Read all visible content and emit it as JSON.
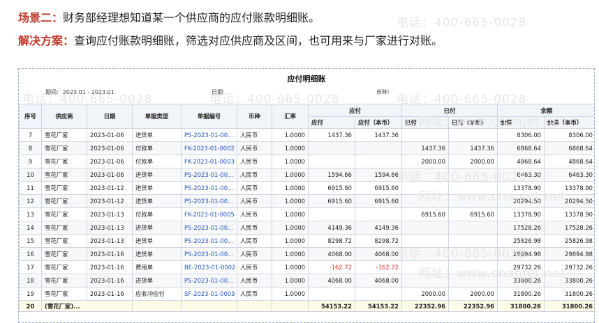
{
  "scenario": {
    "label": "场景二：",
    "text": "财务部经理想知道某一个供应商的应付账款明细账。"
  },
  "solution": {
    "label": "解决方案：",
    "text": "查询应付账款明细账，筛选对应供应商及区间，也可用来与厂家进行对账。"
  },
  "watermarks": {
    "phone": "电话：400-665-0028",
    "site": "网址：www.chanjet.net"
  },
  "report": {
    "title": "应付明细账",
    "period_label": "期间:",
    "period_value": "2023.01 - 2023.01",
    "date_label": "日期:",
    "currency_label": "币种:"
  },
  "columns": {
    "seq": "序号",
    "supplier": "供应商",
    "date": "日期",
    "doc_type": "单据类型",
    "doc_no": "单据编号",
    "currency": "币种",
    "rate": "汇率",
    "payable": "应付",
    "paid": "已付",
    "balance": "余额",
    "payable_amt": "应付",
    "payable_local": "应付（本币）",
    "paid_amt": "已付",
    "paid_local": "已付（本币）",
    "balance_amt": "余额",
    "balance_local": "余额（本币）"
  },
  "rows": [
    {
      "seq": "7",
      "supplier": "雪花厂家",
      "date": "2023-01-06",
      "type": "进货单",
      "no": "PS-2023-01-00...",
      "cur": "人民币",
      "rate": "1.0000",
      "pay": "1437.36",
      "payl": "1437.36",
      "paid": "",
      "paidl": "",
      "bal": "8306.00",
      "ball": "8306.00"
    },
    {
      "seq": "8",
      "supplier": "雪花厂家",
      "date": "2023-01-06",
      "type": "付款单",
      "no": "FK-2023-01-0002",
      "cur": "人民币",
      "rate": "1.0000",
      "pay": "",
      "payl": "",
      "paid": "1437.36",
      "paidl": "1437.36",
      "bal": "6868.64",
      "ball": "6868.64"
    },
    {
      "seq": "9",
      "supplier": "雪花厂家",
      "date": "2023-01-06",
      "type": "付款单",
      "no": "FK-2023-01-0003",
      "cur": "人民币",
      "rate": "1.0000",
      "pay": "",
      "payl": "",
      "paid": "2000.00",
      "paidl": "2000.00",
      "bal": "4868.64",
      "ball": "4868.64"
    },
    {
      "seq": "10",
      "supplier": "雪花厂家",
      "date": "2023-01-06",
      "type": "进货单",
      "no": "PS-2023-01-00...",
      "cur": "人民币",
      "rate": "1.0000",
      "pay": "1594.66",
      "payl": "1594.66",
      "paid": "",
      "paidl": "",
      "bal": "6463.30",
      "ball": "6463.30"
    },
    {
      "seq": "11",
      "supplier": "雪花厂家",
      "date": "2023-01-12",
      "type": "进货单",
      "no": "PS-2023-01-00...",
      "cur": "人民币",
      "rate": "1.0000",
      "pay": "6915.60",
      "payl": "6915.60",
      "paid": "",
      "paidl": "",
      "bal": "13378.90",
      "ball": "13378.90"
    },
    {
      "seq": "12",
      "supplier": "雪花厂家",
      "date": "2023-01-12",
      "type": "进货单",
      "no": "PS-2023-01-00...",
      "cur": "人民币",
      "rate": "1.0000",
      "pay": "6915.60",
      "payl": "6915.60",
      "paid": "",
      "paidl": "",
      "bal": "20294.50",
      "ball": "20294.50"
    },
    {
      "seq": "13",
      "supplier": "雪花厂家",
      "date": "2023-01-13",
      "type": "付款单",
      "no": "FK-2023-01-0005",
      "cur": "人民币",
      "rate": "1.0000",
      "pay": "",
      "payl": "",
      "paid": "6915.60",
      "paidl": "6915.60",
      "bal": "13378.90",
      "ball": "13378.90"
    },
    {
      "seq": "14",
      "supplier": "雪花厂家",
      "date": "2023-01-13",
      "type": "进货单",
      "no": "PS-2023-01-00...",
      "cur": "人民币",
      "rate": "1.0000",
      "pay": "4149.36",
      "payl": "4149.36",
      "paid": "",
      "paidl": "",
      "bal": "17528.26",
      "ball": "17528.26"
    },
    {
      "seq": "15",
      "supplier": "雪花厂家",
      "date": "2023-01-13",
      "type": "进货单",
      "no": "PS-2023-01-00...",
      "cur": "人民币",
      "rate": "1.0000",
      "pay": "8298.72",
      "payl": "8298.72",
      "paid": "",
      "paidl": "",
      "bal": "25826.98",
      "ball": "25826.98"
    },
    {
      "seq": "16",
      "supplier": "雪花厂家",
      "date": "2023-01-16",
      "type": "进货单",
      "no": "PS-2023-01-00...",
      "cur": "人民币",
      "rate": "1.0000",
      "pay": "4068.00",
      "payl": "4068.00",
      "paid": "",
      "paidl": "",
      "bal": "29894.98",
      "ball": "29894.98"
    },
    {
      "seq": "17",
      "supplier": "雪花厂家",
      "date": "2023-01-16",
      "type": "费用单",
      "no": "BE-2023-01-0002",
      "cur": "人民币",
      "rate": "1.0000",
      "pay": "-162.72",
      "payl": "-162.72",
      "paid": "",
      "paidl": "",
      "bal": "29732.26",
      "ball": "29732.26"
    },
    {
      "seq": "18",
      "supplier": "雪花厂家",
      "date": "2023-01-16",
      "type": "进货单",
      "no": "PS-2023-01-00...",
      "cur": "人民币",
      "rate": "1.0000",
      "pay": "4068.00",
      "payl": "4068.00",
      "paid": "",
      "paidl": "",
      "bal": "33800.26",
      "ball": "33800.26"
    },
    {
      "seq": "19",
      "supplier": "雪花厂家",
      "date": "2023-01-16",
      "type": "应收冲应付",
      "no": "SF-2023-01-0003",
      "cur": "人民币",
      "rate": "1.0000",
      "pay": "",
      "payl": "",
      "paid": "2000.00",
      "paidl": "2000.00",
      "bal": "31800.26",
      "ball": "31800.26"
    }
  ],
  "total": {
    "seq": "20",
    "supplier": "(雪花厂家)...",
    "pay": "54153.22",
    "payl": "54153.22",
    "paid": "22352.96",
    "paidl": "22352.96",
    "bal": "31800.26",
    "ball": "31800.26"
  }
}
